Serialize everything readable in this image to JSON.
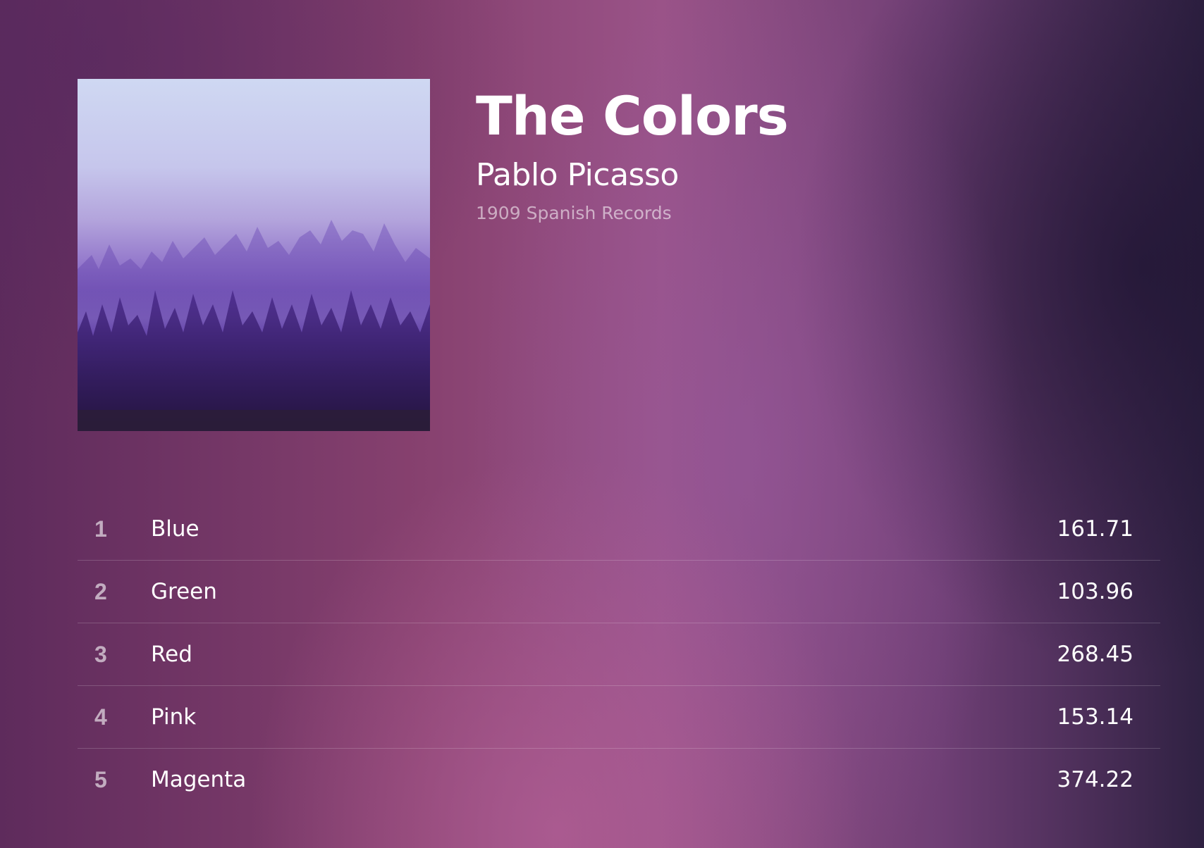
{
  "album": {
    "title": "The Colors",
    "artist": "Pablo Picasso",
    "year": "1909",
    "label": "Spanish Records",
    "cover_description_icon": "album-cover"
  },
  "tracks": [
    {
      "number": "1",
      "name": "Blue",
      "duration": "161.71"
    },
    {
      "number": "2",
      "name": "Green",
      "duration": "103.96"
    },
    {
      "number": "3",
      "name": "Red",
      "duration": "268.45"
    },
    {
      "number": "4",
      "name": "Pink",
      "duration": "153.14"
    },
    {
      "number": "5",
      "name": "Magenta",
      "duration": "374.22"
    }
  ],
  "colors": {
    "background_primary": "#87416f",
    "background_dark": "#2f2142",
    "text": "#ffffff"
  }
}
